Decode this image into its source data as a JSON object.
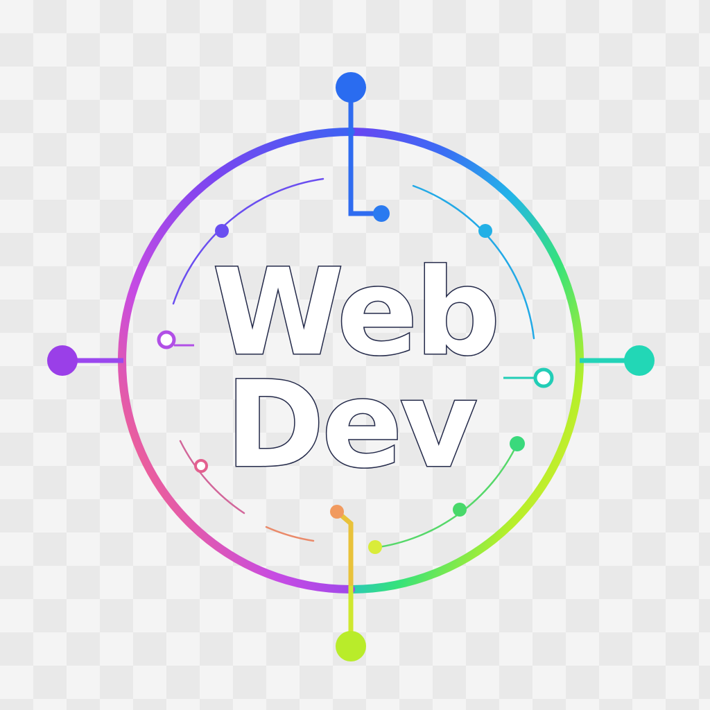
{
  "logo": {
    "line1": "Web",
    "line2": "Dev"
  },
  "colors": {
    "ring_gradient": [
      "#3b6cf4",
      "#23a8f2",
      "#22d7c4",
      "#3ee86a",
      "#a8ef2a",
      "#f7e53a",
      "#f58b5a",
      "#ef4fae",
      "#b84ef1",
      "#7a45f0"
    ],
    "text_fill": "#ffffff",
    "text_outline": "#242a4a",
    "background_checker": [
      "#f4f4f4",
      "#e9e9e9"
    ]
  },
  "icons": [
    "circuit-ring-icon",
    "connector-node-icon",
    "circuit-trace-icon"
  ]
}
